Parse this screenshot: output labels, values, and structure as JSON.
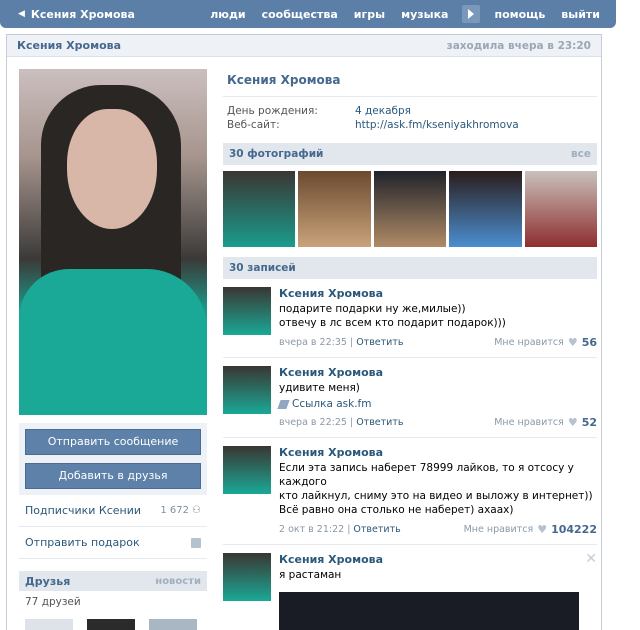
{
  "header": {
    "back_label": "Ксения Хромова",
    "nav": [
      "люди",
      "сообщества",
      "игры",
      "музыка",
      "помощь",
      "выйти"
    ]
  },
  "page": {
    "name": "Ксения Хромова",
    "last_seen": "заходила вчера в 23:20"
  },
  "profile": {
    "name": "Ксения Хромова",
    "birthday_label": "День рождения:",
    "birthday_value": "4 декабря",
    "website_label": "Веб-сайт:",
    "website_value": "http://ask.fm/kseniyakhromova"
  },
  "left": {
    "send_message": "Отправить сообщение",
    "add_friend": "Добавить в друзья",
    "followers_label": "Подписчики Ксении",
    "followers_count": "1 672",
    "gift_label": "Отправить подарок",
    "friends_title": "Друзья",
    "friends_news": "новости",
    "friends_count": "77 друзей"
  },
  "photos": {
    "title": "30 фотографий",
    "all": "все"
  },
  "wall": {
    "title": "30 записей",
    "posts": [
      {
        "author": "Ксения Хромова",
        "text": "подарите подарки ну же,милые))\nотвечу в лс всем кто подарит подарок)))",
        "date": "вчера в 22:35",
        "reply": "Ответить",
        "like_label": "Мне нравится",
        "likes": "56"
      },
      {
        "author": "Ксения Хромова",
        "text": "удивите меня)",
        "link": "Ссылка ask.fm",
        "date": "вчера в 22:25",
        "reply": "Ответить",
        "like_label": "Мне нравится",
        "likes": "52"
      },
      {
        "author": "Ксения Хромова",
        "text": "Если эта запись наберет 78999 лайков, то я отсосу у каждого\nкто лайкнул, сниму это на видео и выложу в интернет))\nВсё равно она столько не наберет) ахаах)",
        "date": "2 окт в 21:22",
        "reply": "Ответить",
        "like_label": "Мне нравится",
        "likes": "104222"
      },
      {
        "author": "Ксения Хромова",
        "text": "я растаман"
      }
    ]
  }
}
